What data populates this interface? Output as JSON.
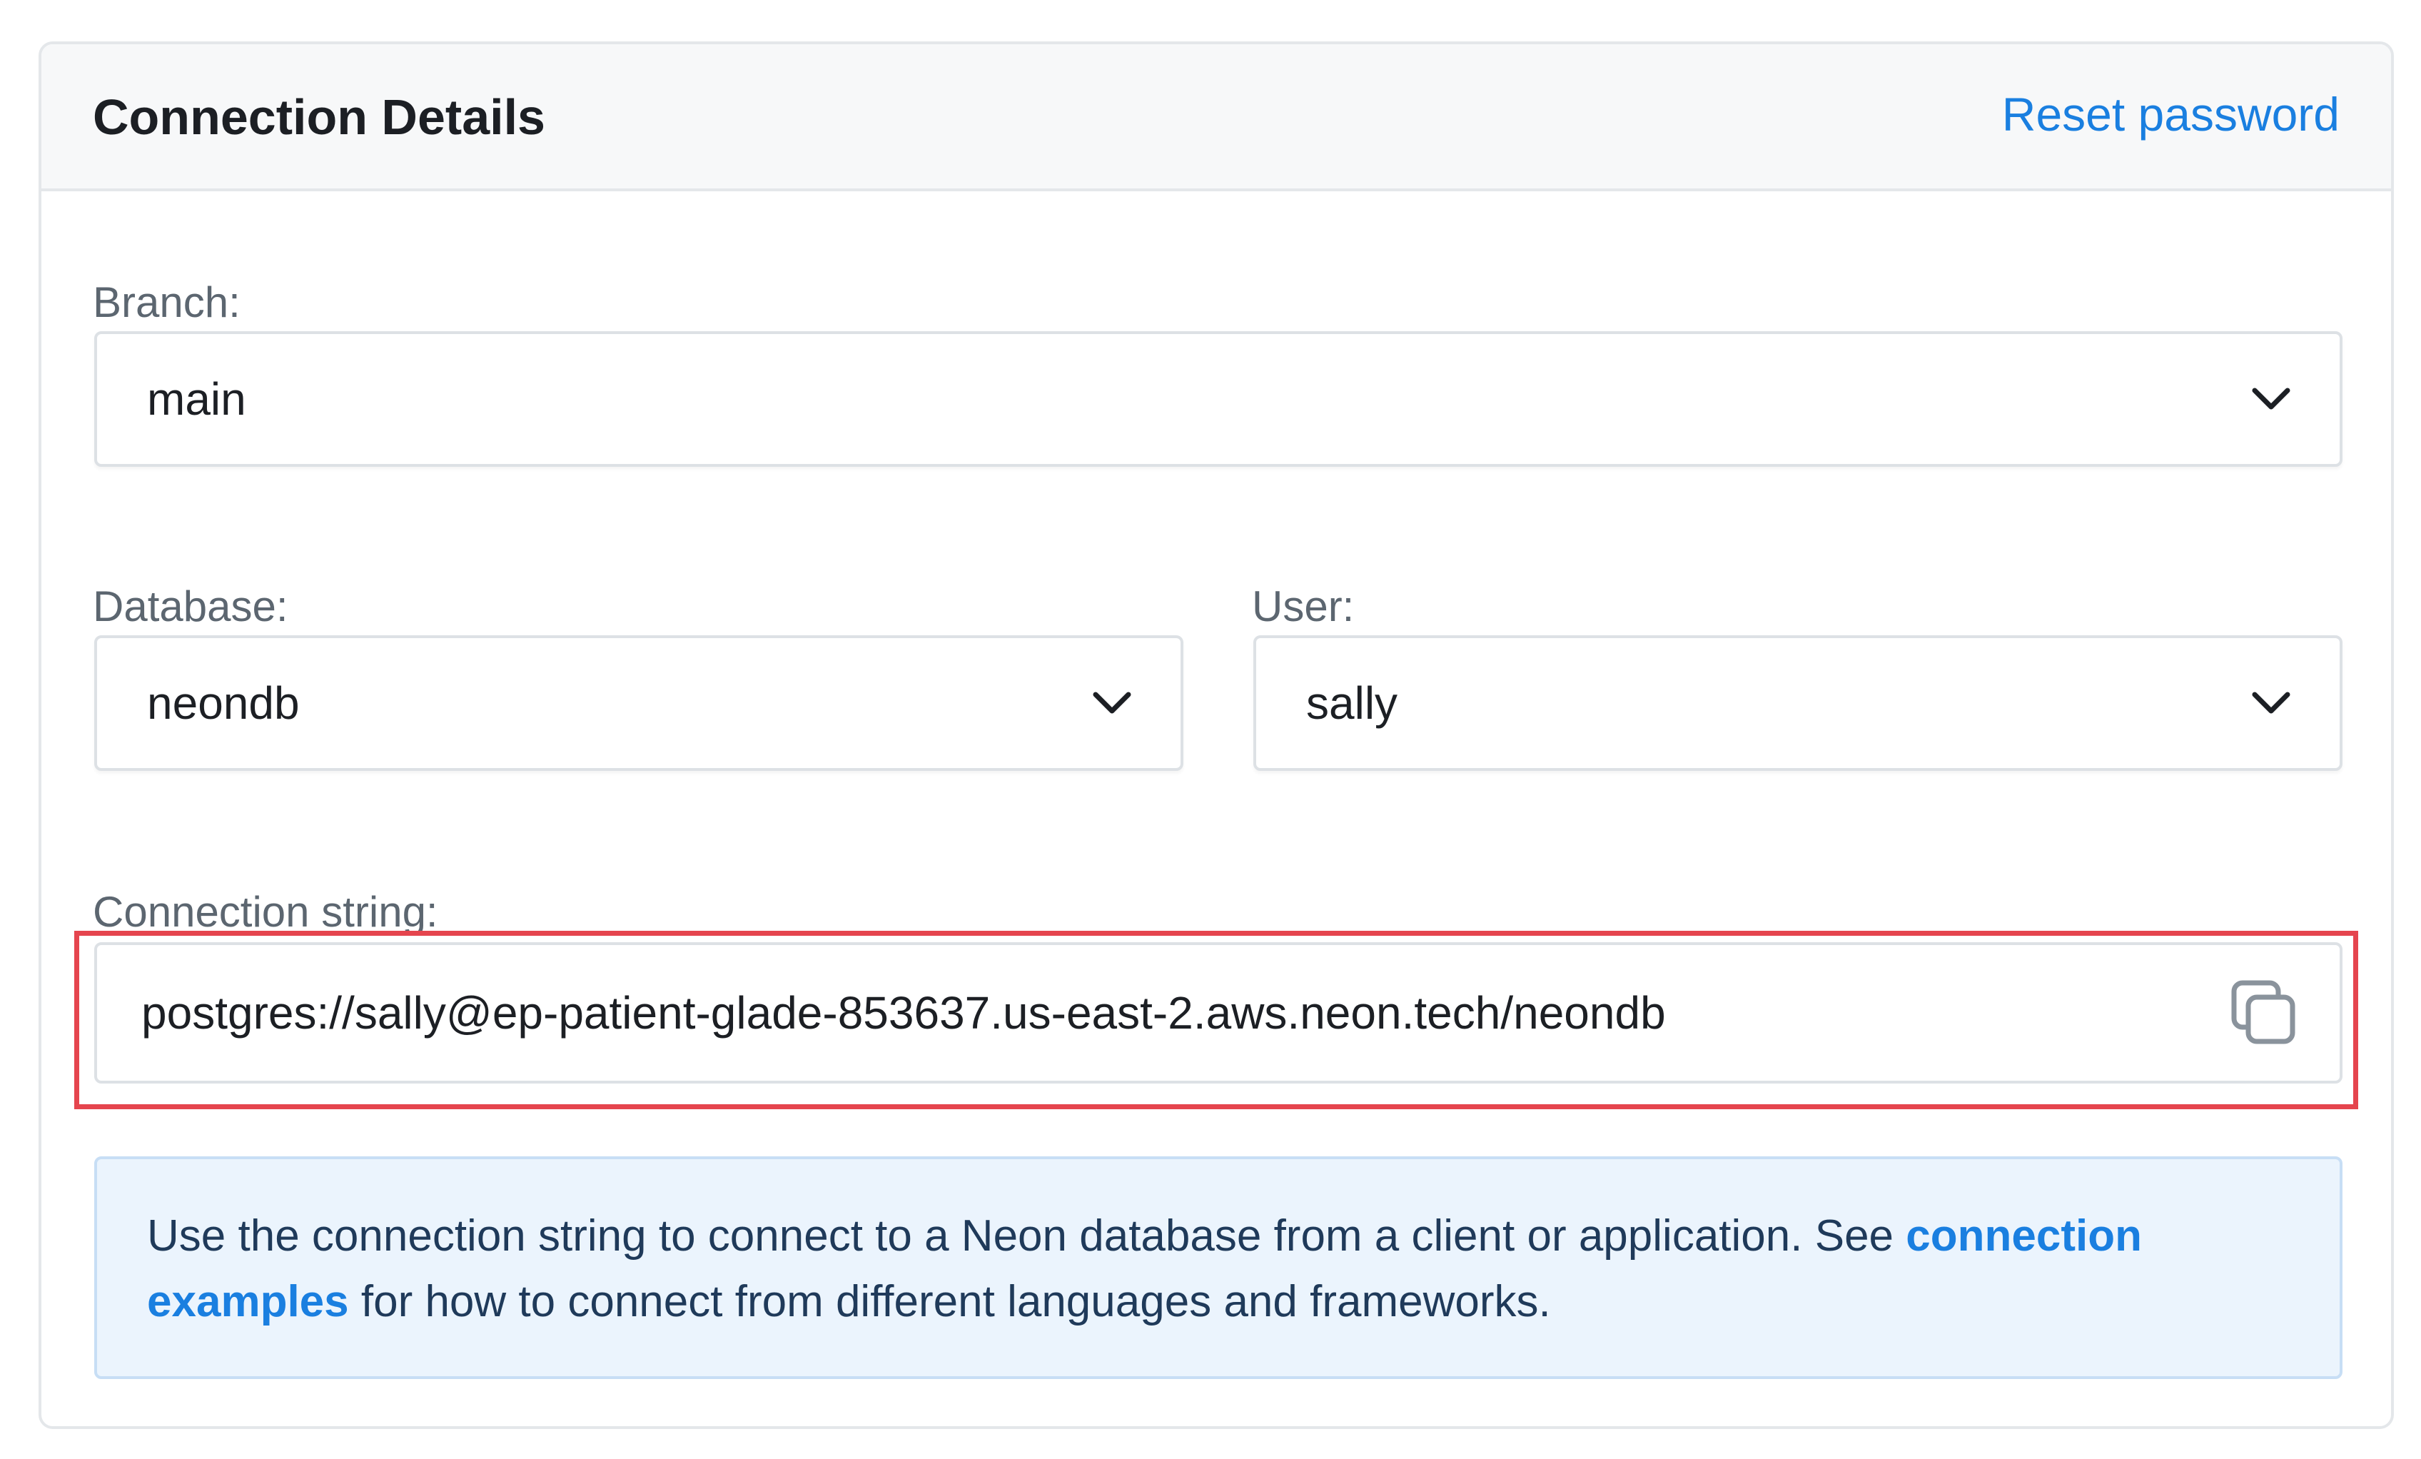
{
  "header": {
    "title": "Connection Details",
    "reset_password_label": "Reset password"
  },
  "branch": {
    "label": "Branch:",
    "value": "main"
  },
  "database": {
    "label": "Database:",
    "value": "neondb"
  },
  "user": {
    "label": "User:",
    "value": "sally"
  },
  "connection_string": {
    "label": "Connection string:",
    "value": "postgres://sally@ep-patient-glade-853637.us-east-2.aws.neon.tech/neondb"
  },
  "info": {
    "text_before": "Use the connection string to connect to a Neon database from a client or application. See ",
    "link_text": "connection examples",
    "text_after": " for how to connect from different languages and frameworks."
  },
  "icons": {
    "select_chevron": "chevron-down-icon",
    "copy": "copy-icon"
  },
  "colors": {
    "accent": "#1a7fe0",
    "highlight_border": "#e5454e",
    "info_background": "#ebf4fd"
  }
}
